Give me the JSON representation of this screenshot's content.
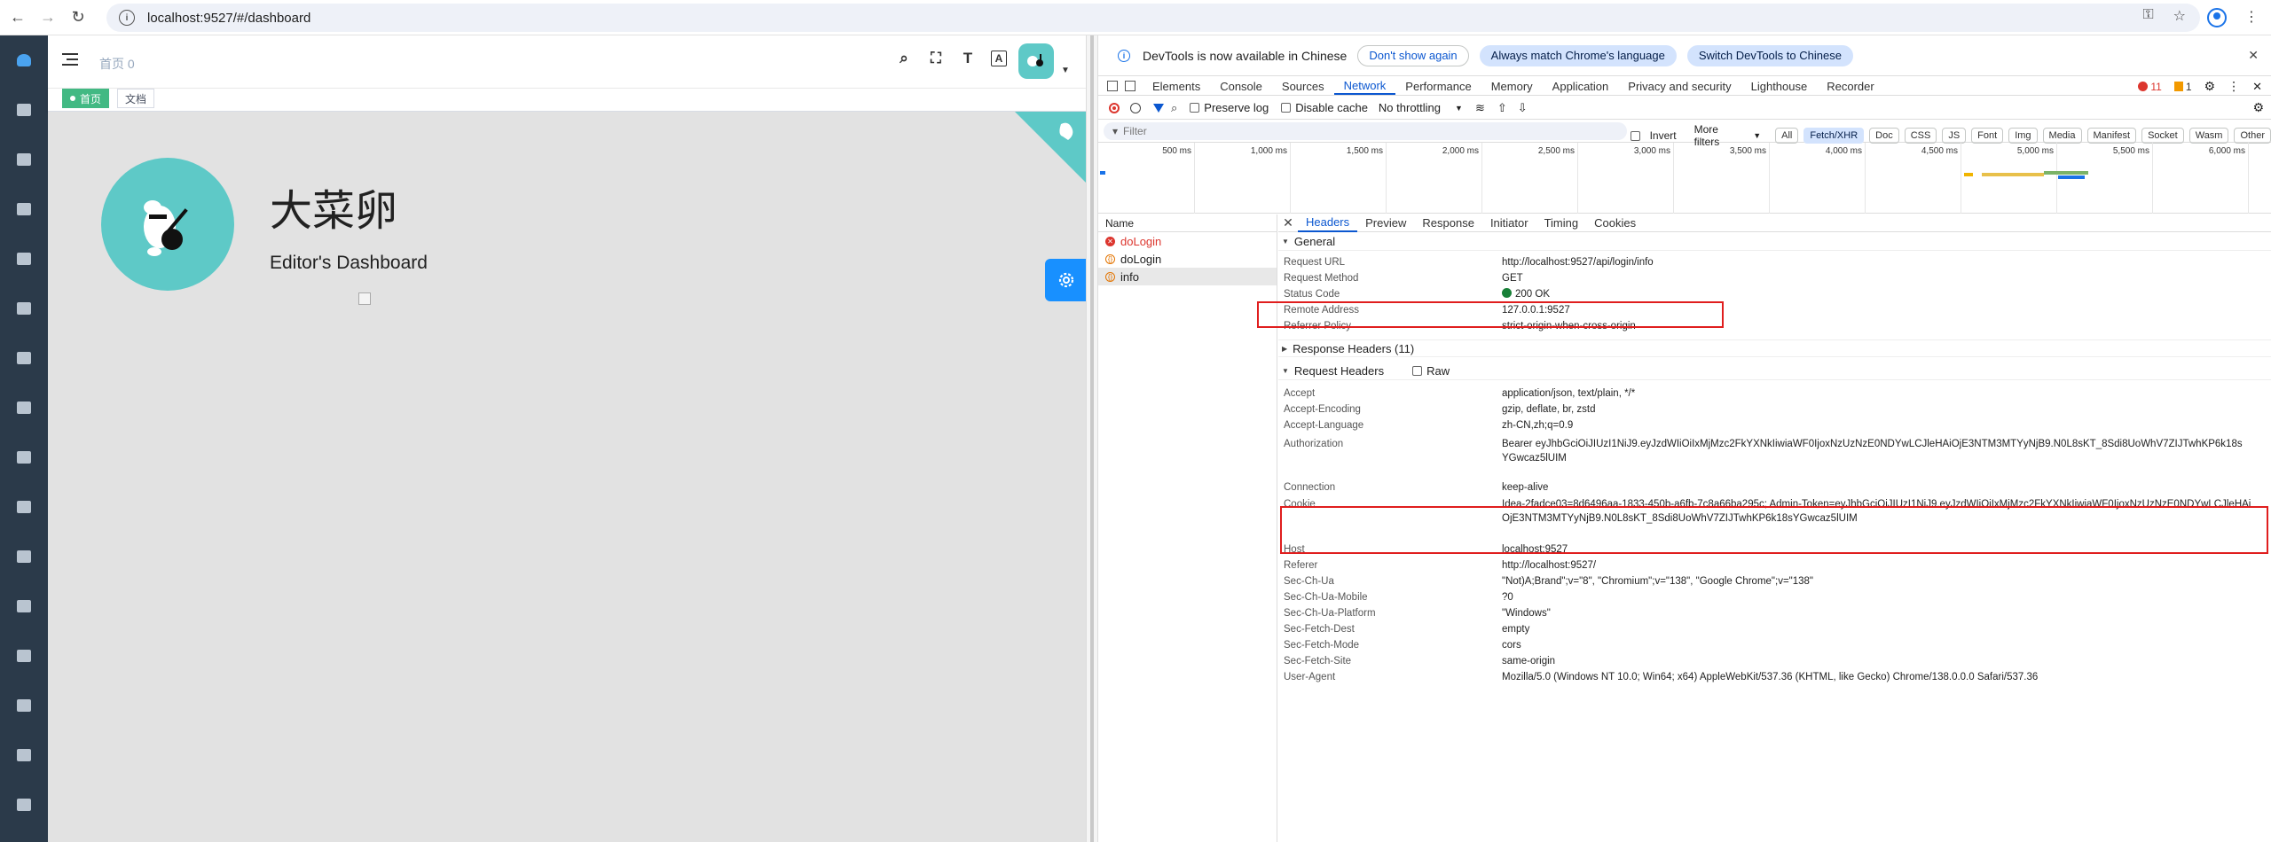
{
  "browser": {
    "url": "localhost:9527/#/dashboard"
  },
  "app": {
    "breadcrumb": "首页 0",
    "tags": [
      "首页",
      "文档"
    ],
    "title": "大菜卵",
    "subtitle": "Editor's Dashboard"
  },
  "devtools": {
    "infobar": {
      "message": "DevTools is now available in Chinese",
      "btn_dont_show": "Don't show again",
      "btn_match": "Always match Chrome's language",
      "btn_switch": "Switch DevTools to Chinese"
    },
    "tabs": [
      "Elements",
      "Console",
      "Sources",
      "Network",
      "Performance",
      "Memory",
      "Application",
      "Privacy and security",
      "Lighthouse",
      "Recorder"
    ],
    "selected_tab": "Network",
    "error_count": "11",
    "warning_count": "1",
    "toolbar": {
      "preserve_log": "Preserve log",
      "disable_cache": "Disable cache",
      "throttling": "No throttling"
    },
    "filter": {
      "placeholder": "Filter",
      "invert": "Invert",
      "more_filters": "More filters",
      "chips": [
        "All",
        "Fetch/XHR",
        "Doc",
        "CSS",
        "JS",
        "Font",
        "Img",
        "Media",
        "Manifest",
        "Socket",
        "Wasm",
        "Other"
      ],
      "selected_chip": "Fetch/XHR"
    },
    "timeline_ticks": [
      "500 ms",
      "1,000 ms",
      "1,500 ms",
      "2,000 ms",
      "2,500 ms",
      "3,000 ms",
      "3,500 ms",
      "4,000 ms",
      "4,500 ms",
      "5,000 ms",
      "5,500 ms",
      "6,000 ms"
    ],
    "name_header": "Name",
    "requests": [
      {
        "name": "doLogin",
        "status": "error"
      },
      {
        "name": "doLogin",
        "status": "xhr"
      },
      {
        "name": "info",
        "status": "xhr"
      }
    ],
    "detail_tabs": [
      "Headers",
      "Preview",
      "Response",
      "Initiator",
      "Timing",
      "Cookies"
    ],
    "general": {
      "title": "General",
      "rows": [
        {
          "k": "Request URL",
          "v": "http://localhost:9527/api/login/info"
        },
        {
          "k": "Request Method",
          "v": "GET"
        },
        {
          "k": "Status Code",
          "v": "200 OK"
        },
        {
          "k": "Remote Address",
          "v": "127.0.0.1:9527"
        },
        {
          "k": "Referrer Policy",
          "v": "strict-origin-when-cross-origin"
        }
      ]
    },
    "response_headers_title": "Response Headers (11)",
    "request_headers_title": "Request Headers",
    "raw_label": "Raw",
    "request_headers": [
      {
        "k": "Accept",
        "v": "application/json, text/plain, */*"
      },
      {
        "k": "Accept-Encoding",
        "v": "gzip, deflate, br, zstd"
      },
      {
        "k": "Accept-Language",
        "v": "zh-CN,zh;q=0.9"
      },
      {
        "k": "Authorization",
        "v": "Bearer eyJhbGciOiJIUzI1NiJ9.eyJzdWIiOiIxMjMzc2FkYXNkIiwiaWF0IjoxNzUzNzE0NDYwLCJleHAiOjE3NTM3MTYyNjB9.N0L8sKT_8Sdi8UoWhV7ZIJTwhKP6k18sYGwcaz5lUIM"
      },
      {
        "k": "Connection",
        "v": "keep-alive"
      },
      {
        "k": "Cookie",
        "v": "Idea-2fadce03=8d6496aa-1833-450b-a6fb-7c8a66ba295c; Admin-Token=eyJhbGciOiJIUzI1NiJ9.eyJzdWIiOiIxMjMzc2FkYXNkIiwiaWF0IjoxNzUzNzE0NDYwLCJleHAiOjE3NTM3MTYyNjB9.N0L8sKT_8Sdi8UoWhV7ZIJTwhKP6k18sYGwcaz5lUIM"
      },
      {
        "k": "Host",
        "v": "localhost:9527"
      },
      {
        "k": "Referer",
        "v": "http://localhost:9527/"
      },
      {
        "k": "Sec-Ch-Ua",
        "v": "\"Not)A;Brand\";v=\"8\", \"Chromium\";v=\"138\", \"Google Chrome\";v=\"138\""
      },
      {
        "k": "Sec-Ch-Ua-Mobile",
        "v": "?0"
      },
      {
        "k": "Sec-Ch-Ua-Platform",
        "v": "\"Windows\""
      },
      {
        "k": "Sec-Fetch-Dest",
        "v": "empty"
      },
      {
        "k": "Sec-Fetch-Mode",
        "v": "cors"
      },
      {
        "k": "Sec-Fetch-Site",
        "v": "same-origin"
      },
      {
        "k": "User-Agent",
        "v": "Mozilla/5.0 (Windows NT 10.0; Win64; x64) AppleWebKit/537.36 (KHTML, like Gecko) Chrome/138.0.0.0 Safari/537.36"
      }
    ]
  },
  "colors": {
    "accent": "#0b57d0",
    "highlight": "#e01e1e",
    "sidebar": "#2b3a4a",
    "tag_active": "#42b983",
    "avatar_bg": "#5ec9c7"
  },
  "icons": {
    "browser": [
      "back-icon",
      "forward-icon",
      "reload-icon",
      "info-icon",
      "key-icon",
      "star-icon",
      "profile-icon",
      "more-icon"
    ],
    "sidebar": [
      "dashboard-icon",
      "document-icon",
      "guide-icon",
      "permission-icon",
      "component-icon",
      "chart-icon",
      "nested-icon",
      "table-icon",
      "example-icon",
      "tab-icon",
      "error-icon",
      "bug-icon",
      "excel-icon",
      "zip-icon",
      "pdf-icon",
      "theme-icon"
    ],
    "header": [
      "search-icon",
      "fullscreen-icon",
      "size-icon",
      "language-icon"
    ]
  }
}
